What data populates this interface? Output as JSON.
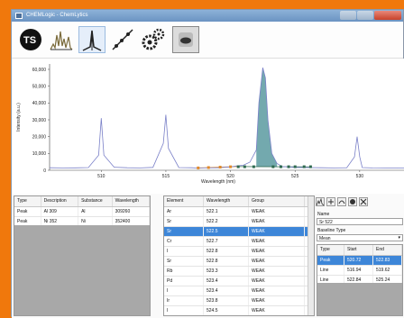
{
  "window": {
    "title": "CHEMLogic - ChemLytics"
  },
  "toolbar": {
    "icons": [
      "tsi-logo-icon",
      "spectra-library-icon",
      "peak-tool-icon",
      "calibration-curve-icon",
      "settings-gears-icon",
      "camera-icon"
    ]
  },
  "chart_data": {
    "type": "line",
    "ylabel": "Intensity (a.u.)",
    "xlabel": "Wavelength (nm)",
    "yticks": [
      "60,000",
      "50,000",
      "40,000",
      "30,000",
      "20,000",
      "10,000",
      "0"
    ],
    "ylim": [
      0,
      60000
    ],
    "xticks": [
      "510",
      "515",
      "520",
      "525",
      "530"
    ],
    "xlim": [
      506,
      533.5
    ],
    "series": [
      {
        "x": [
          506,
          507,
          508,
          509,
          509.8,
          510,
          510.2,
          511,
          512,
          513,
          514,
          514.8,
          515,
          515.2,
          516,
          517,
          517.5,
          518,
          519,
          520,
          520.5,
          521,
          521.5,
          522,
          522.2,
          522.5,
          522.7,
          522.9,
          523.2,
          523.6,
          524,
          525,
          526,
          527,
          528,
          529,
          529.6,
          529.8,
          530,
          530.2,
          531,
          532,
          533,
          533.5
        ],
        "y": [
          1500,
          1400,
          1450,
          1600,
          9000,
          31000,
          9000,
          1800,
          1500,
          1400,
          1700,
          16000,
          33000,
          13000,
          1600,
          1500,
          1300,
          1400,
          1500,
          2000,
          2600,
          3000,
          4800,
          12000,
          40000,
          61000,
          55000,
          30000,
          10000,
          4000,
          2200,
          1700,
          1600,
          1500,
          1400,
          1500,
          8000,
          20000,
          8000,
          1600,
          1400,
          1350,
          1400,
          1400
        ]
      }
    ],
    "baseline_markers": [
      517.5,
      518.3,
      519.2,
      520,
      520.6,
      521.1,
      521.8,
      523.3,
      523.9,
      524.5,
      525,
      525.7,
      526.2
    ],
    "shaded_range": [
      521.8,
      523.6
    ]
  },
  "peaks_table": {
    "headers": [
      "Type",
      "Description",
      "Substance",
      "Wavelength"
    ],
    "rows": [
      [
        "Peak",
        "Al 309",
        "Al",
        "309260"
      ],
      [
        "Peak",
        "Ni 352",
        "Ni",
        "352400"
      ]
    ]
  },
  "elements_table": {
    "headers": [
      "Element",
      "Wavelength",
      "Group"
    ],
    "rows": [
      [
        "Ar",
        "522.1",
        "WEAK"
      ],
      [
        "Sr",
        "522.2",
        "WEAK"
      ],
      [
        "Sr",
        "522.5",
        "WEAK"
      ],
      [
        "Cr",
        "522.7",
        "WEAK"
      ],
      [
        "I",
        "522.8",
        "WEAK"
      ],
      [
        "Sr",
        "522.8",
        "WEAK"
      ],
      [
        "Rb",
        "523.3",
        "WEAK"
      ],
      [
        "Pd",
        "523.4",
        "WEAK"
      ],
      [
        "I",
        "523.4",
        "WEAK"
      ],
      [
        "Ir",
        "523.8",
        "WEAK"
      ],
      [
        "I",
        "524.5",
        "WEAK"
      ]
    ],
    "selected_index": 2
  },
  "details": {
    "name_label": "Name",
    "name_value": "Sr 522",
    "baseline_label": "Baseline Type",
    "baseline_value": "Mean",
    "headers": [
      "Type",
      "Start",
      "End"
    ],
    "rows": [
      [
        "Peak",
        "520.72",
        "522.83"
      ],
      [
        "Line",
        "516.94",
        "519.62"
      ],
      [
        "Line",
        "522.84",
        "525.24"
      ]
    ]
  },
  "small_buttons": [
    "spectrum-view-icon",
    "peak-add-icon",
    "curve-icon",
    "remove-icon",
    "close-icon"
  ]
}
